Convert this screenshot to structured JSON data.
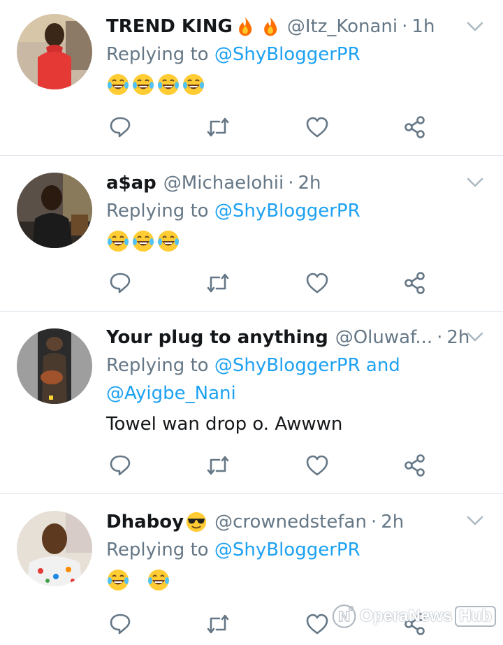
{
  "tweets": [
    {
      "display_name": "TREND KING",
      "name_emoji": [
        "fire-emoji",
        "fire-emoji"
      ],
      "handle": "@Itz_Konani",
      "time": "1h",
      "reply_prefix": "Replying to",
      "reply_mentions": "@ShyBloggerPR",
      "reply_mentions_2": "",
      "body": "",
      "emojis": [
        "laughing-crying-emoji",
        "laughing-crying-emoji",
        "laughing-crying-emoji",
        "laughing-crying-emoji"
      ]
    },
    {
      "display_name": "a$ap",
      "name_emoji": [],
      "handle": "@Michaelohii",
      "time": "2h",
      "reply_prefix": "Replying to",
      "reply_mentions": "@ShyBloggerPR",
      "reply_mentions_2": "",
      "body": "",
      "emojis": [
        "laughing-crying-emoji",
        "laughing-crying-emoji",
        "laughing-crying-emoji"
      ]
    },
    {
      "display_name": "Your plug to anything",
      "name_emoji": [],
      "handle": "@Oluwaf...",
      "time": "2h",
      "reply_prefix": "Replying to",
      "reply_mentions": "@ShyBloggerPR and",
      "reply_mentions_2": "@Ayigbe_Nani",
      "body": "Towel wan drop o. Awwwn",
      "emojis": []
    },
    {
      "display_name": "Dhaboy",
      "name_emoji": [
        "sunglasses-emoji"
      ],
      "handle": "@crownedstefan",
      "time": "2h",
      "reply_prefix": "Replying to",
      "reply_mentions": "@ShyBloggerPR",
      "reply_mentions_2": "",
      "body": "",
      "emojis": [
        "laughing-crying-emoji",
        "laughing-crying-emoji"
      ]
    }
  ],
  "separator": "·",
  "action_icons": [
    "reply-icon",
    "retweet-icon",
    "like-icon",
    "share-icon"
  ],
  "watermark": {
    "brand": "OperaNews",
    "hub": "Hub"
  },
  "colors": {
    "link": "#1da1f2",
    "secondary_text": "#657786",
    "icon": "#657786",
    "divider": "#e1e8ed"
  }
}
